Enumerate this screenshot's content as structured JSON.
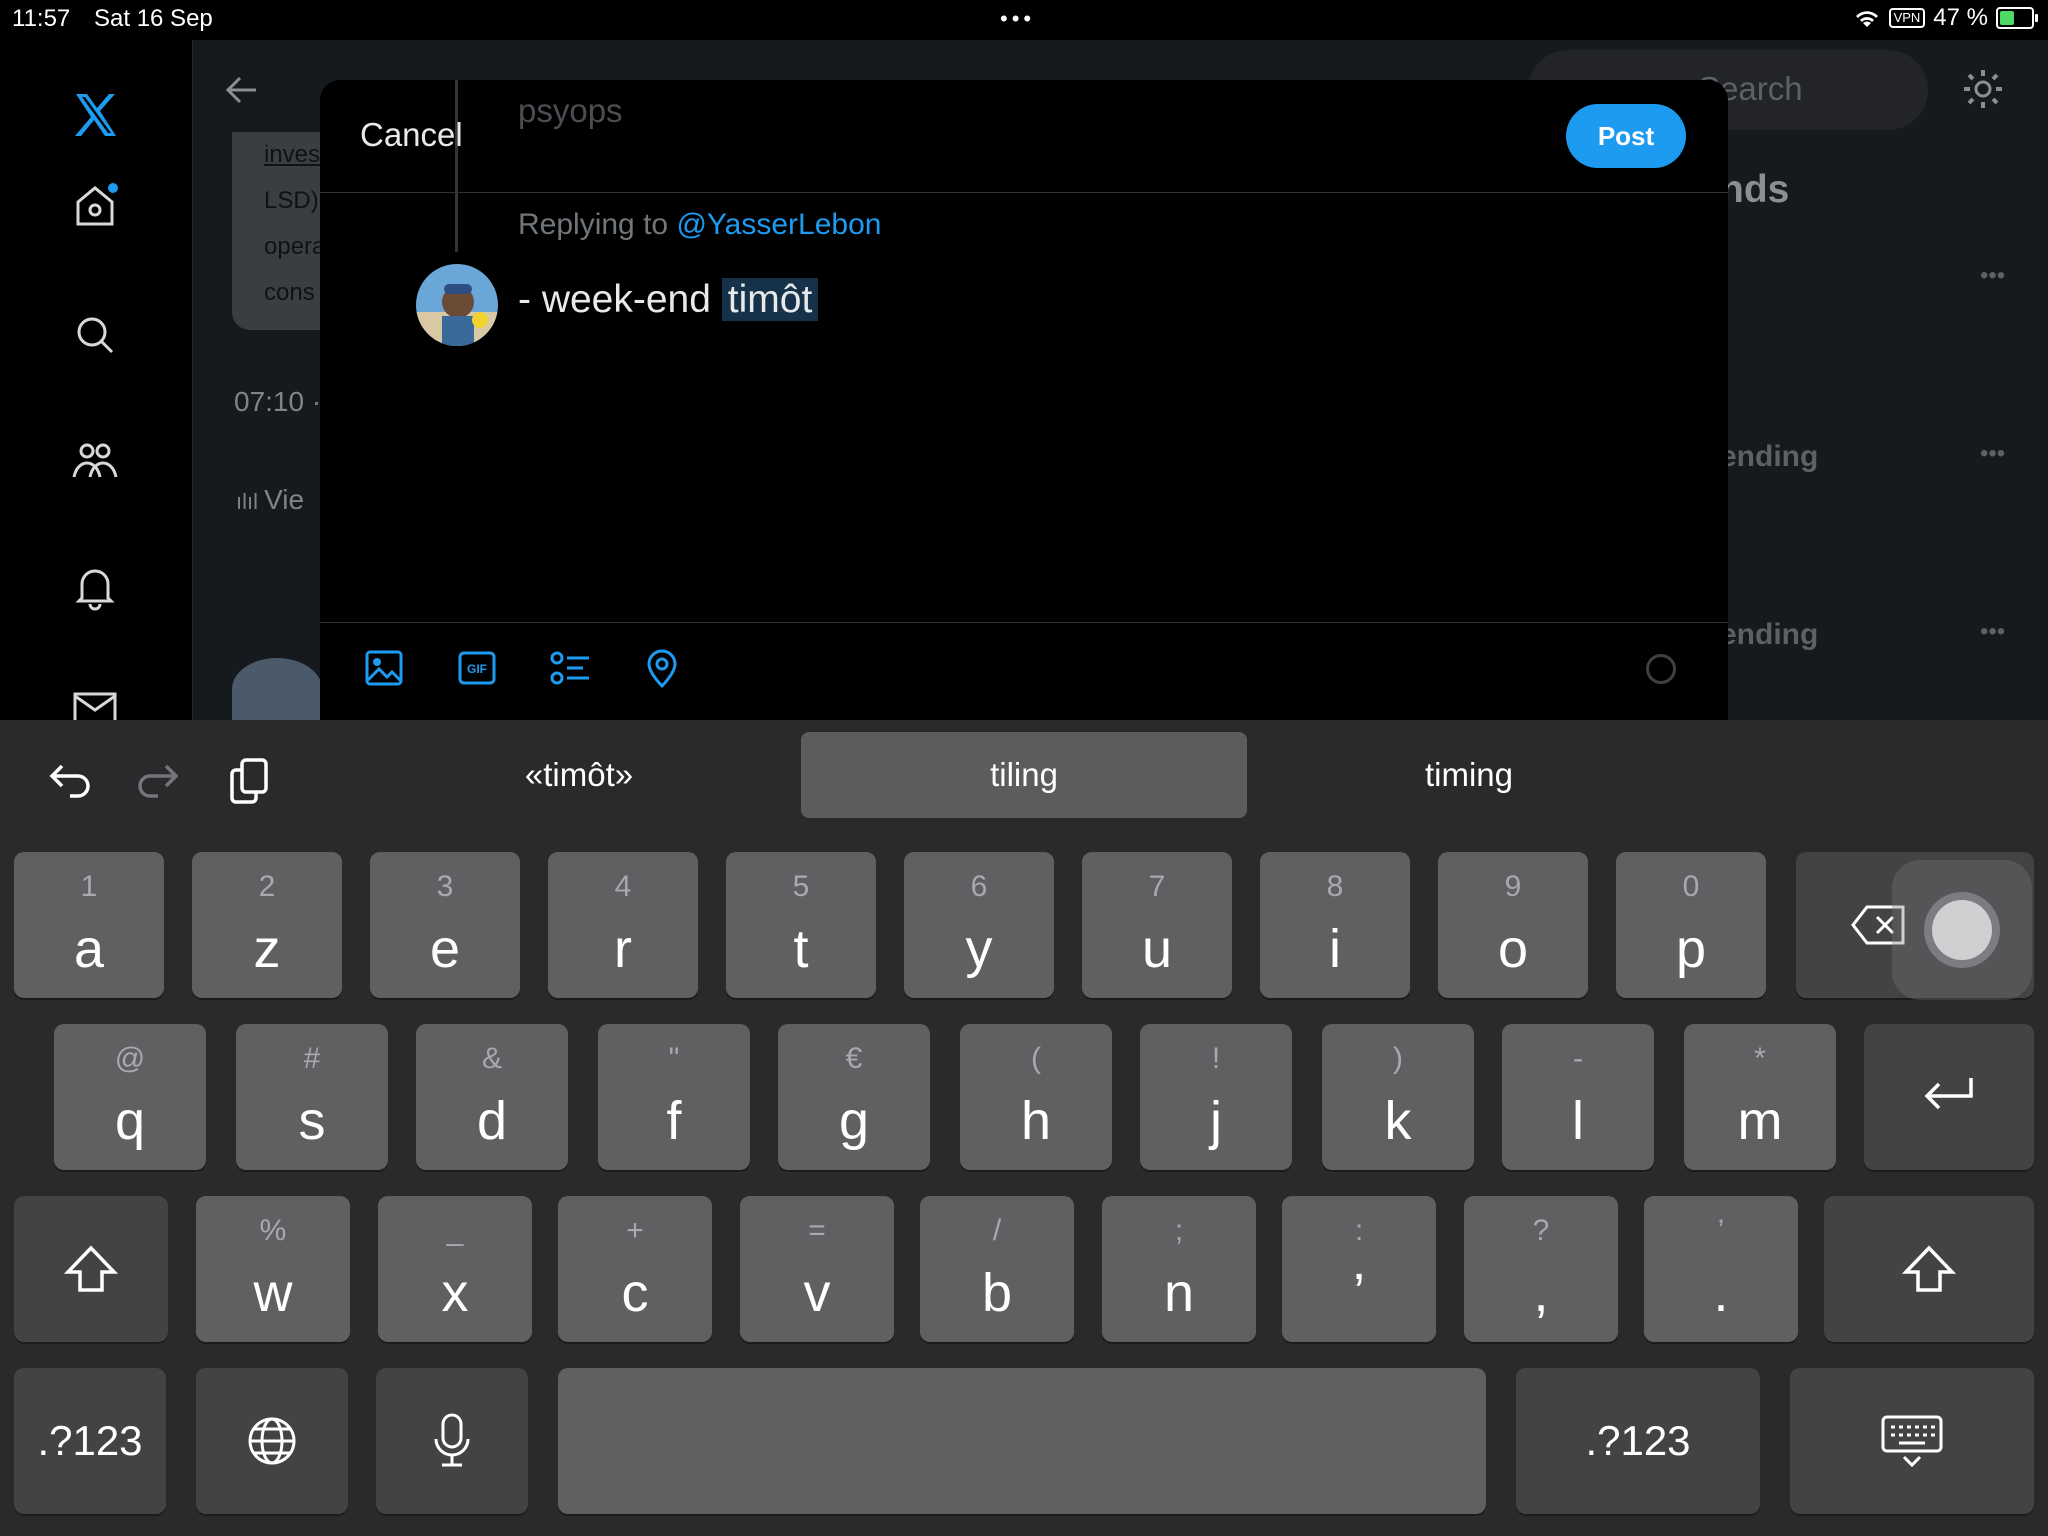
{
  "status_bar": {
    "time": "11:57",
    "date": "Sat 16 Sep",
    "vpn": "VPN",
    "battery": "47 %"
  },
  "background": {
    "snippet_lines": [
      "inves",
      "LSD)",
      "opera",
      "cons"
    ],
    "timestamp": "07:10 ·",
    "views": "Vie",
    "search_placeholder": "Search",
    "trends_title": "nds",
    "trending_1": "ending",
    "trending_2": "ending"
  },
  "composer": {
    "cancel": "Cancel",
    "post": "Post",
    "quoted_text": "psyops",
    "replying_to_prefix": "Replying to ",
    "replying_to_handle": "@YasserLebon",
    "text_before": "- week-end ",
    "text_selected": "timôt"
  },
  "keyboard": {
    "suggestions": [
      "«timôt»",
      "tiling",
      "timing"
    ],
    "row1": [
      {
        "main": "a",
        "sub": "1"
      },
      {
        "main": "z",
        "sub": "2"
      },
      {
        "main": "e",
        "sub": "3"
      },
      {
        "main": "r",
        "sub": "4"
      },
      {
        "main": "t",
        "sub": "5"
      },
      {
        "main": "y",
        "sub": "6"
      },
      {
        "main": "u",
        "sub": "7"
      },
      {
        "main": "i",
        "sub": "8"
      },
      {
        "main": "o",
        "sub": "9"
      },
      {
        "main": "p",
        "sub": "0"
      }
    ],
    "row2": [
      {
        "main": "q",
        "sub": "@"
      },
      {
        "main": "s",
        "sub": "#"
      },
      {
        "main": "d",
        "sub": "&"
      },
      {
        "main": "f",
        "sub": "\""
      },
      {
        "main": "g",
        "sub": "€"
      },
      {
        "main": "h",
        "sub": "("
      },
      {
        "main": "j",
        "sub": "!"
      },
      {
        "main": "k",
        "sub": ")"
      },
      {
        "main": "l",
        "sub": "-"
      },
      {
        "main": "m",
        "sub": "*"
      }
    ],
    "row3": [
      {
        "main": "w",
        "sub": "%"
      },
      {
        "main": "x",
        "sub": "_"
      },
      {
        "main": "c",
        "sub": "+"
      },
      {
        "main": "v",
        "sub": "="
      },
      {
        "main": "b",
        "sub": "/"
      },
      {
        "main": "n",
        "sub": ";"
      },
      {
        "main": "’",
        "sub": ":"
      },
      {
        "main": ",",
        "sub": "?"
      },
      {
        "main": ".",
        "sub": "’"
      }
    ],
    "numbers_left": ".?123",
    "numbers_right": ".?123"
  },
  "colors": {
    "accent": "#1d9bf0",
    "key": "#606063",
    "key_dark": "#434346",
    "keyboard_bg": "#2a2a2c"
  },
  "icons": [
    "x-logo-icon",
    "home-icon",
    "search-icon",
    "communities-icon",
    "bell-icon",
    "mail-icon",
    "back-arrow-icon",
    "gear-icon",
    "image-icon",
    "gif-icon",
    "poll-icon",
    "location-icon",
    "undo-icon",
    "redo-icon",
    "paste-icon",
    "backspace-icon",
    "return-icon",
    "shift-icon",
    "globe-icon",
    "mic-icon",
    "keyboard-dismiss-icon"
  ]
}
